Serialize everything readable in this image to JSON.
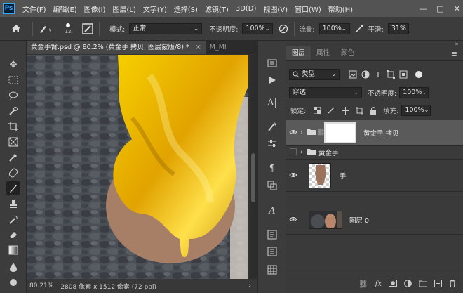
{
  "menubar": {
    "logo": "Ps",
    "items": [
      "文件(F)",
      "编辑(E)",
      "图像(I)",
      "图层(L)",
      "文字(Y)",
      "选择(S)",
      "滤镜(T)",
      "3D(D)",
      "视图(V)",
      "窗口(W)",
      "帮助(H)"
    ],
    "controls": [
      "—",
      "□",
      "✕"
    ]
  },
  "options": {
    "brush_size": "12",
    "mode_label": "模式:",
    "mode_value": "正常",
    "opacity_label": "不透明度:",
    "opacity_value": "100%",
    "flow_label": "流量:",
    "flow_value": "100%",
    "smooth_label": "平滑:",
    "smooth_value": "31%"
  },
  "tabs": [
    {
      "label": "黄金手臂.psd @ 80.2% (黄金手 拷贝, 图层蒙版/8) *"
    },
    {
      "label": "M_MI"
    }
  ],
  "tab_close": "×",
  "status": {
    "zoom": "80.21%",
    "doc_info": "2808 像素 x 1512 像素 (72 ppi)",
    "arrow": "›"
  },
  "panel": {
    "tabs": [
      "图层",
      "属性",
      "颜色"
    ],
    "menu_icon": "≡",
    "collapse_icon": "»",
    "filter_label": "类型",
    "blend_mode": "穿透",
    "opacity_label": "不透明度:",
    "opacity_value": "100%",
    "lock_label": "锁定:",
    "fill_label": "填充:",
    "fill_value": "100%",
    "layers": [
      {
        "name": "黄金手 拷贝",
        "visible": true,
        "type": "group-mask"
      },
      {
        "name": "黄金手",
        "visible": false,
        "type": "group"
      },
      {
        "name": "手",
        "visible": true,
        "type": "pixel"
      },
      {
        "name": "图层 0",
        "visible": true,
        "type": "pixel"
      }
    ]
  },
  "icons": {
    "home": "home-icon",
    "brush": "brush-icon"
  },
  "colors": {
    "gold": "#e8b100",
    "selected_layer": "#5a5a5a",
    "accent": "#31a8ff"
  }
}
